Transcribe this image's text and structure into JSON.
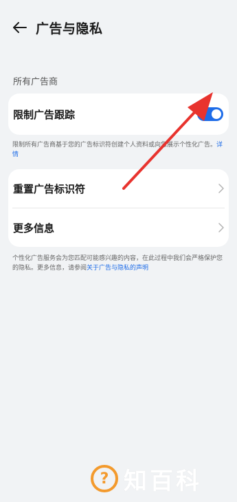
{
  "header": {
    "title": "广告与隐私",
    "back_icon": "arrow-left-icon"
  },
  "section": {
    "label": "所有广告商"
  },
  "limit_tracking": {
    "label": "限制广告跟踪",
    "enabled": true,
    "accent": "#1e6ce8",
    "note": "限制所有广告商基于您的广告标识符创建个人资料或向您展示个性化广告。",
    "note_link": "详情"
  },
  "list": {
    "items": [
      {
        "label": "重置广告标识符",
        "icon": "chevron-right-icon"
      },
      {
        "label": "更多信息",
        "icon": "chevron-right-icon"
      }
    ]
  },
  "footer": {
    "text": "个性化广告服务会为您匹配可能感兴趣的内容，在此过程中我们会严格保护您的隐私。更多信息，请参阅",
    "link": "关于广告与隐私的声明"
  },
  "watermark": {
    "logo_glyph": "?",
    "text": "知百科"
  }
}
